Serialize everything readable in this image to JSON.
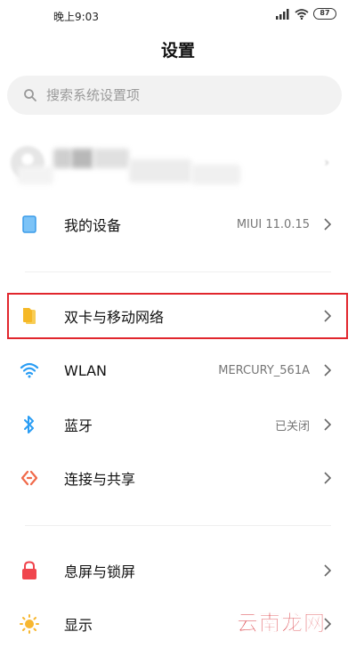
{
  "status_bar": {
    "time": "晚上9:03",
    "battery": "87"
  },
  "header": {
    "title": "设置"
  },
  "search": {
    "placeholder": "搜索系统设置项"
  },
  "items": [
    {
      "label": "我的设备",
      "value": "MIUI 11.0.15",
      "icon": "phone-icon"
    },
    {
      "label": "双卡与移动网络",
      "value": "",
      "icon": "sim-card-icon"
    },
    {
      "label": "WLAN",
      "value": "MERCURY_561A",
      "icon": "wifi-icon"
    },
    {
      "label": "蓝牙",
      "value": "已关闭",
      "icon": "bluetooth-icon"
    },
    {
      "label": "连接与共享",
      "value": "",
      "icon": "share-icon"
    },
    {
      "label": "息屏与锁屏",
      "value": "",
      "icon": "lock-icon"
    },
    {
      "label": "显示",
      "value": "",
      "icon": "sun-icon"
    }
  ],
  "colors": {
    "highlight": "#e1262d",
    "sim_icon": "#f5b826",
    "wifi_icon": "#2a9df4",
    "bluetooth_icon": "#2a9df4",
    "share_icon": "#f06a4a",
    "lock_icon": "#f0454d",
    "sun_icon": "#f7b731"
  },
  "watermark": "云南龙网"
}
